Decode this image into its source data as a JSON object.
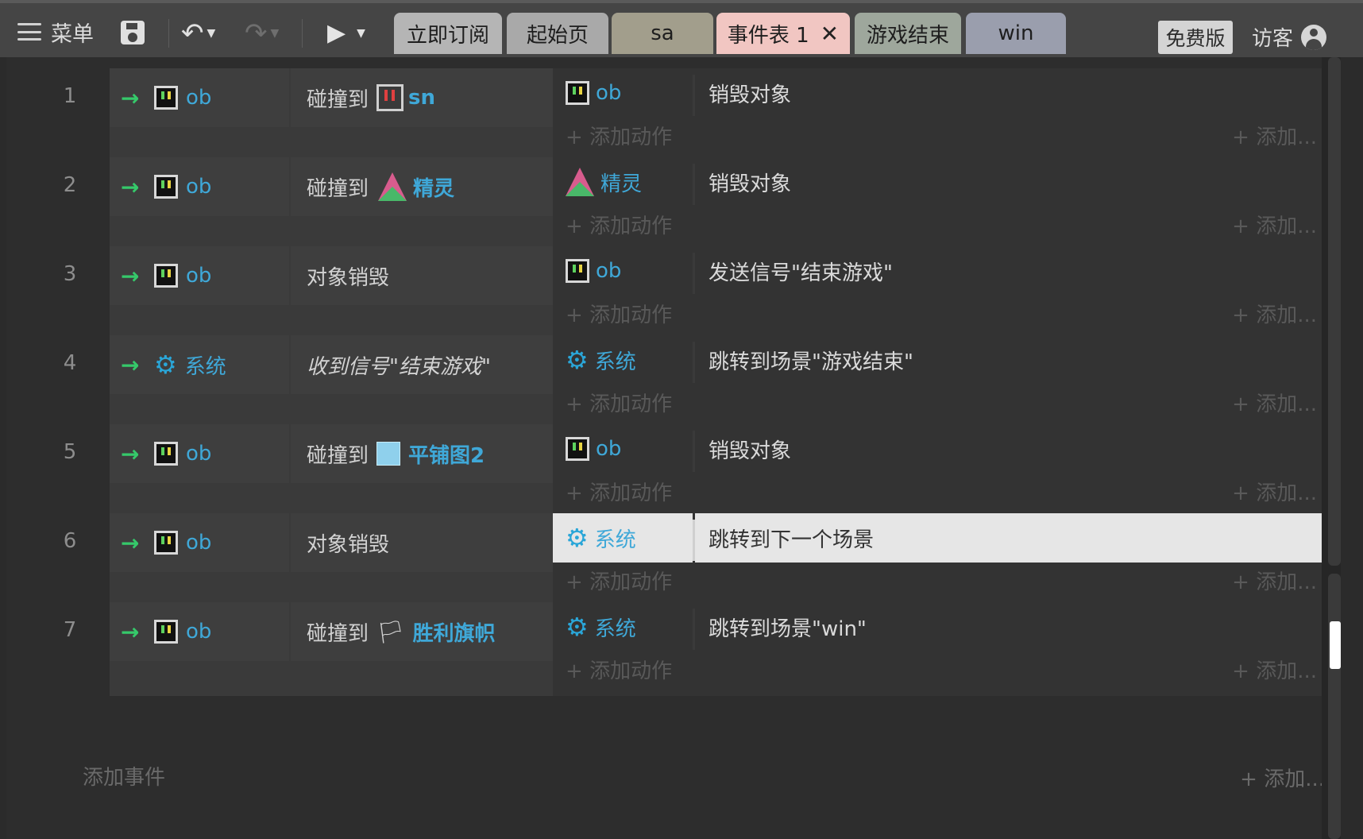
{
  "toolbar": {
    "menu_label": "菜单",
    "undo_icon": "undo-icon",
    "redo_icon": "redo-icon",
    "run_icon": "play-icon",
    "free_badge": "免费版",
    "visitor_label": "访客"
  },
  "tabs": [
    {
      "label": "立即订阅",
      "color": "#b5b5b5"
    },
    {
      "label": "起始页",
      "color": "#a9a9a9"
    },
    {
      "label": "sa",
      "color": "#a29e8c"
    },
    {
      "label": "事件表 1",
      "color": "#f1c6c2",
      "active": true,
      "close": "✕"
    },
    {
      "label": "游戏结束",
      "color": "#9ea79c"
    },
    {
      "label": "win",
      "color": "#9a9ead"
    }
  ],
  "events": [
    {
      "num": "1",
      "cond_obj": "ob",
      "cond_pre": "碰撞到",
      "cond_target": "sn",
      "act_obj": "ob",
      "act_text": "销毁对象"
    },
    {
      "num": "2",
      "cond_obj": "ob",
      "cond_pre": "碰撞到",
      "cond_target": "精灵",
      "act_obj": "精灵",
      "act_text": "销毁对象"
    },
    {
      "num": "3",
      "cond_obj": "ob",
      "cond_pre": "对象销毁",
      "cond_target": "",
      "act_obj": "ob",
      "act_text": "发送信号\"结束游戏\""
    },
    {
      "num": "4",
      "cond_obj": "系统",
      "cond_pre": "收到信号\"结束游戏\"",
      "cond_target": "",
      "act_obj": "系统",
      "act_text": "跳转到场景\"游戏结束\""
    },
    {
      "num": "5",
      "cond_obj": "ob",
      "cond_pre": "碰撞到",
      "cond_target": "平铺图2",
      "act_obj": "ob",
      "act_text": "销毁对象"
    },
    {
      "num": "6",
      "cond_obj": "ob",
      "cond_pre": "对象销毁",
      "cond_target": "",
      "act_obj": "系统",
      "act_text": "跳转到下一个场景",
      "selected": true
    },
    {
      "num": "7",
      "cond_obj": "ob",
      "cond_pre": "碰撞到",
      "cond_target": "胜利旗帜",
      "act_obj": "系统",
      "act_text": "跳转到场景\"win\""
    }
  ],
  "labels": {
    "add_action": "添加动作",
    "add_more": "添加...",
    "add_event": "添加事件"
  }
}
